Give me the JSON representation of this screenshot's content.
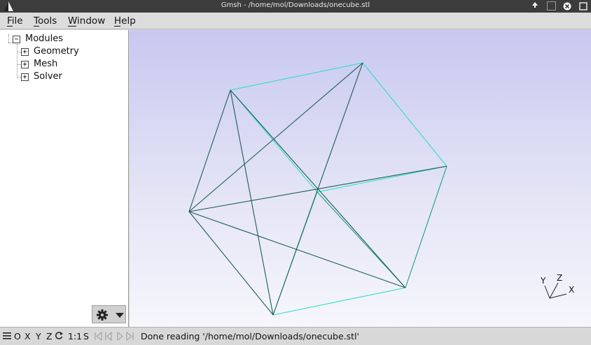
{
  "window": {
    "title": "Gmsh - /home/mol/Downloads/onecube.stl",
    "logo_icon": "gmsh-triangle-icon",
    "controls": [
      "up-arrow-icon",
      "restore-icon",
      "close-icon"
    ]
  },
  "menu": {
    "file": "File",
    "tools": "Tools",
    "window": "Window",
    "help": "Help"
  },
  "tree": {
    "root": {
      "label": "Modules",
      "toggle": "−"
    },
    "children": [
      {
        "label": "Geometry",
        "toggle": "+"
      },
      {
        "label": "Mesh",
        "toggle": "+"
      },
      {
        "label": "Solver",
        "toggle": "+"
      }
    ],
    "options_button_icons": [
      "gear-icon",
      "triangle-down-icon"
    ]
  },
  "graphics": {
    "model": "wireframe cube",
    "edge_colors": {
      "dark": "#1f5e55",
      "light": "#2ee0c4"
    },
    "axes": {
      "x": "X",
      "y": "Y",
      "z": "Z"
    }
  },
  "statusbar": {
    "menu_icon": "hamburger-icon",
    "view_o": "O",
    "view_x": "X",
    "view_y": "Y",
    "view_z": "Z",
    "rotate_icon": "rotate-icon",
    "scale": "1:1",
    "s": "S",
    "nav_icons": [
      "first-icon",
      "previous-icon",
      "play-icon",
      "last-icon"
    ],
    "message": "Done reading '/home/mol/Downloads/onecube.stl'"
  }
}
